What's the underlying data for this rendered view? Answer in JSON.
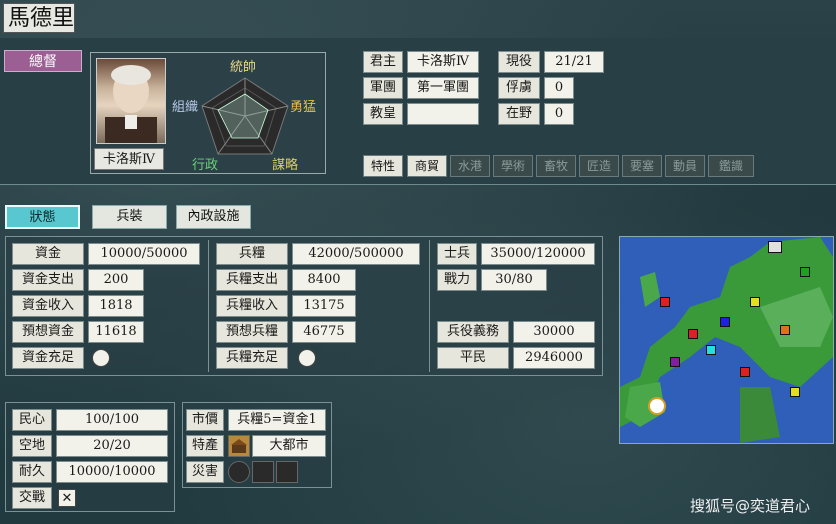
{
  "officer_name": "馬德里",
  "rank": "總督",
  "ruler_name": "卡洛斯Ⅳ",
  "radar": {
    "commander": "統帥",
    "might": "勇猛",
    "strategy": "謀略",
    "admin": "行政",
    "organize": "組織"
  },
  "info": {
    "lord_label": "君主",
    "lord_value": "卡洛斯Ⅳ",
    "army_label": "軍團",
    "army_value": "第一軍團",
    "pope_label": "教皇",
    "pope_value": "",
    "active_label": "現役",
    "active_value": "21/21",
    "captive_label": "俘虜",
    "captive_value": "0",
    "idle_label": "在野",
    "idle_value": "0"
  },
  "traits_label": "特性",
  "traits": [
    {
      "label": "商貿",
      "on": true
    },
    {
      "label": "水港",
      "on": false
    },
    {
      "label": "學術",
      "on": false
    },
    {
      "label": "畜牧",
      "on": false
    },
    {
      "label": "匠造",
      "on": false
    },
    {
      "label": "要塞",
      "on": false
    },
    {
      "label": "動員",
      "on": false
    },
    {
      "label": "鑑識",
      "on": false
    }
  ],
  "tabs": [
    {
      "label": "狀態",
      "active": true
    },
    {
      "label": "兵裝",
      "active": false
    },
    {
      "label": "內政設施",
      "active": false
    }
  ],
  "funds": {
    "funds_label": "資金",
    "funds_value": "10000/50000",
    "expense_label": "資金支出",
    "expense_value": "200",
    "income_label": "資金收入",
    "income_value": "1818",
    "forecast_label": "預想資金",
    "forecast_value": "11618",
    "full_label": "資金充足"
  },
  "food": {
    "food_label": "兵糧",
    "food_value": "42000/500000",
    "expense_label": "兵糧支出",
    "expense_value": "8400",
    "income_label": "兵糧收入",
    "income_value": "13175",
    "forecast_label": "預想兵糧",
    "forecast_value": "46775",
    "full_label": "兵糧充足"
  },
  "troops": {
    "soldiers_label": "士兵",
    "soldiers_value": "35000/120000",
    "power_label": "戰力",
    "power_value": "30/80",
    "duty_label": "兵役義務",
    "duty_value": "30000",
    "civilians_label": "平民",
    "civilians_value": "2946000"
  },
  "city": {
    "morale_label": "民心",
    "morale_value": "100/100",
    "land_label": "空地",
    "land_value": "20/20",
    "durability_label": "耐久",
    "durability_value": "10000/10000",
    "battle_label": "交戰",
    "battle_mark": "✕"
  },
  "market": {
    "price_label": "市價",
    "price_value": "兵糧5=資金1",
    "special_label": "特產",
    "special_value": "大都市",
    "disaster_label": "災害"
  },
  "watermark": "搜狐号@奕道君心",
  "colors": {
    "rank_bg": "#9b5f93",
    "tab_active": "#59c7cf",
    "panel": "#283f45"
  }
}
